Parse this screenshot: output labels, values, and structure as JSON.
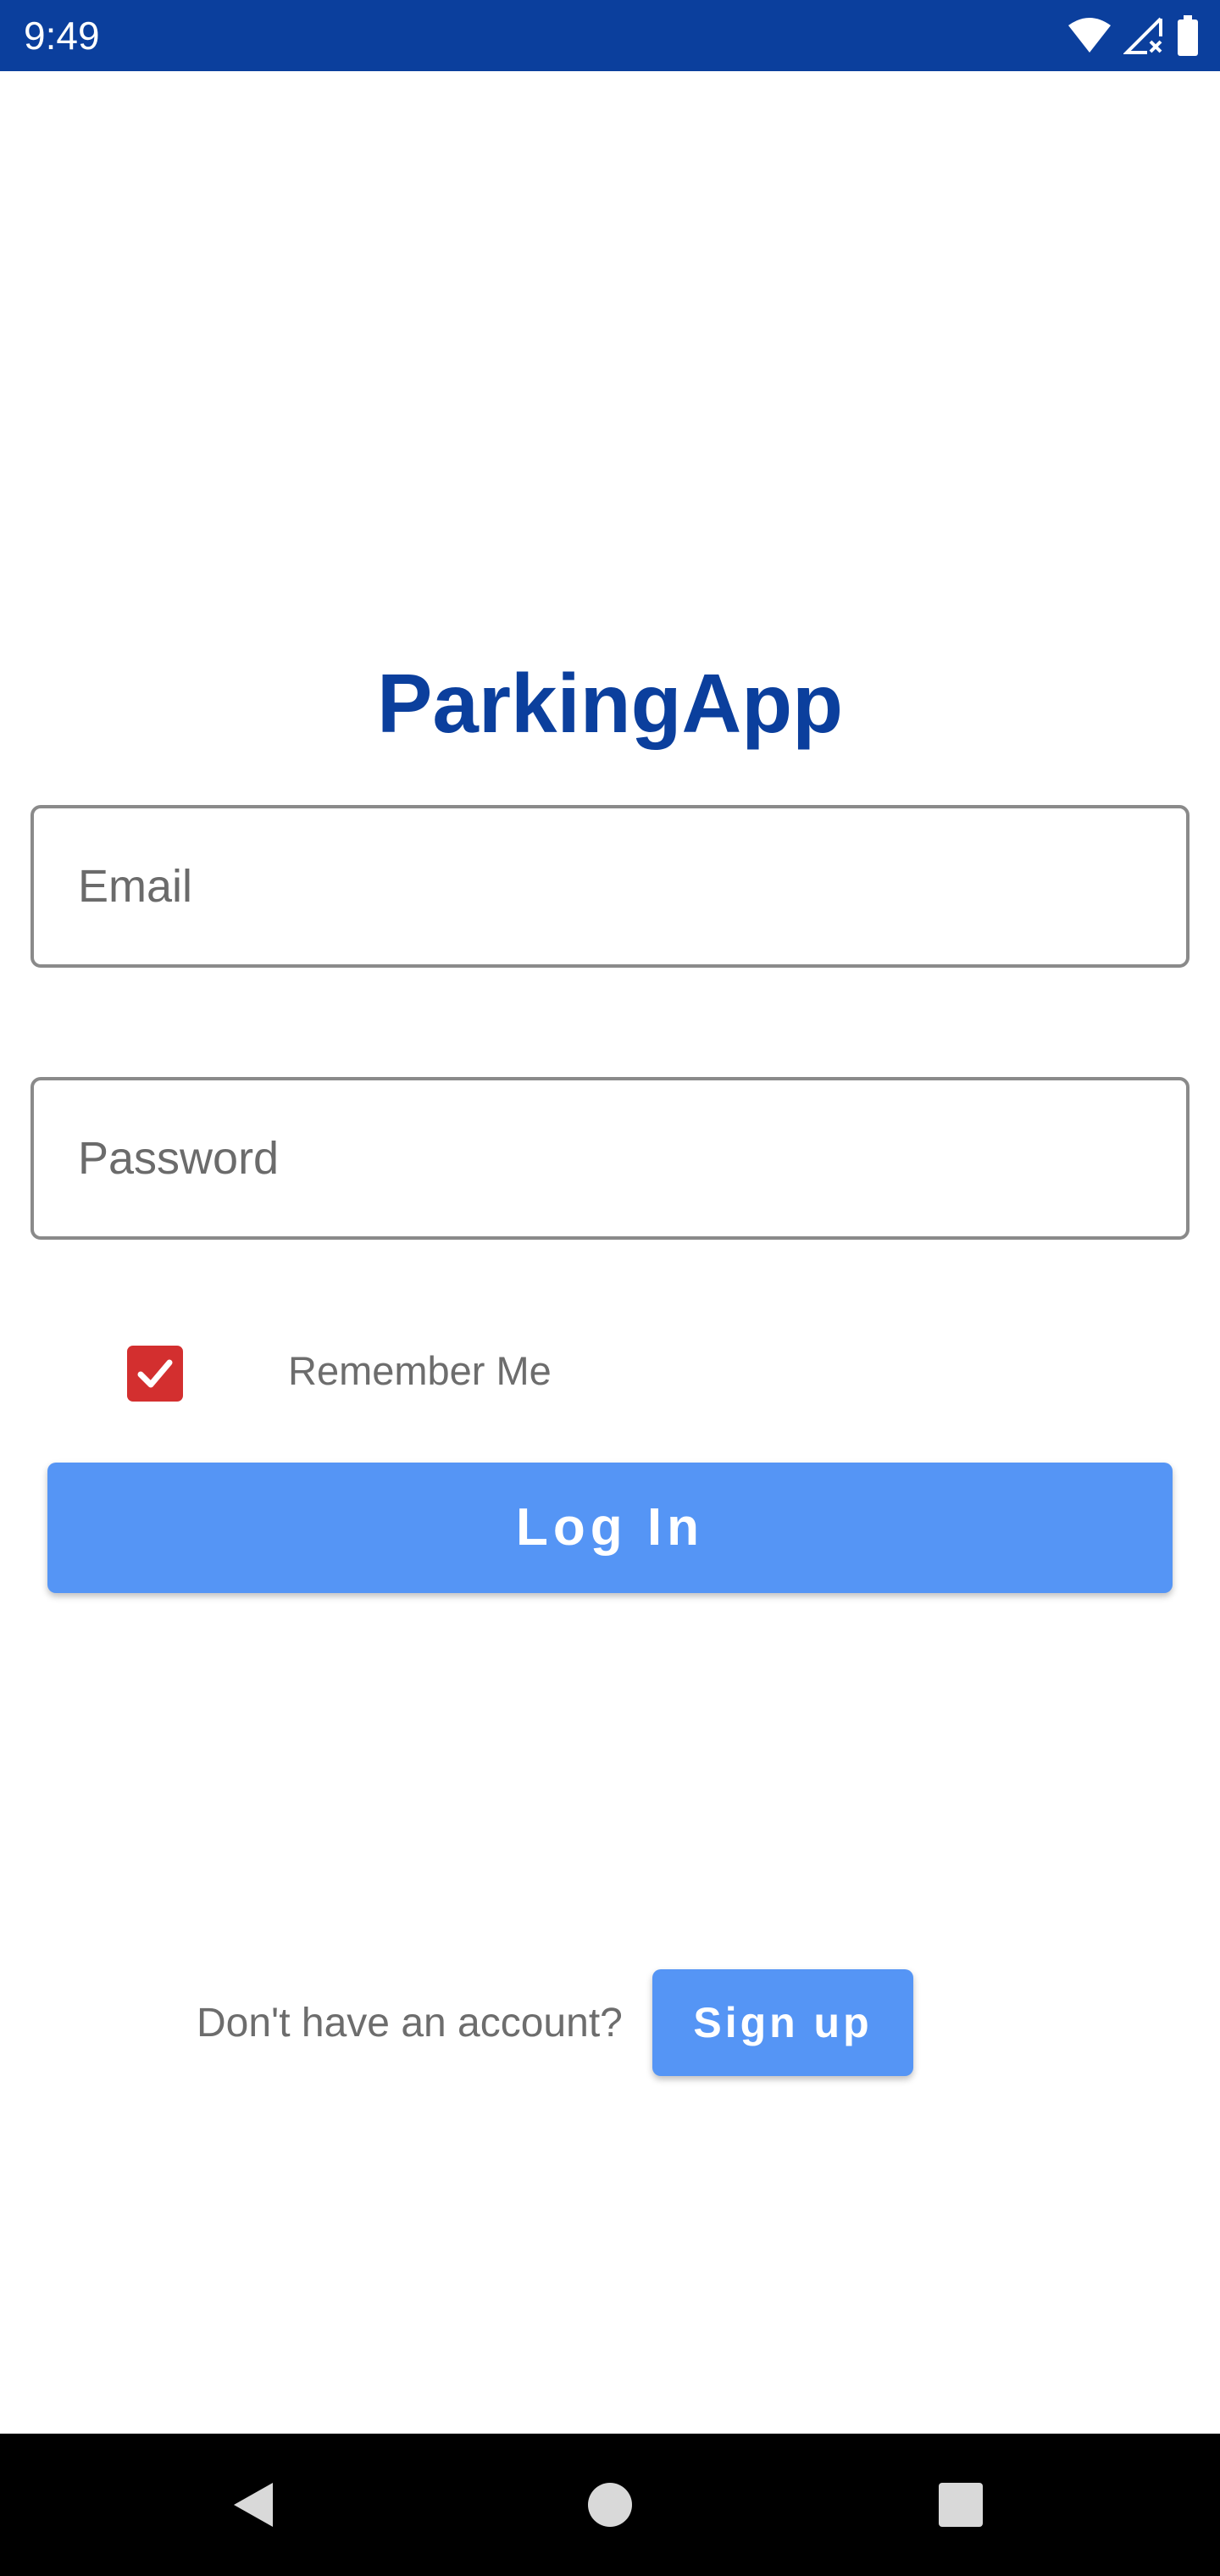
{
  "status_bar": {
    "time": "9:49",
    "icons": [
      "wifi-icon",
      "signal-icon",
      "battery-icon"
    ],
    "background_color": "#0b3f9d"
  },
  "app": {
    "title": "ParkingApp",
    "title_color": "#0b3f9d"
  },
  "form": {
    "email": {
      "placeholder": "Email",
      "value": ""
    },
    "password": {
      "placeholder": "Password",
      "value": ""
    },
    "remember_me": {
      "label": "Remember Me",
      "checked": true,
      "color": "#d32f2f"
    },
    "login_button": {
      "label": "Log In",
      "color": "#5595f5"
    }
  },
  "signup": {
    "prompt": "Don't have an account?",
    "button_label": "Sign up"
  },
  "nav_bar": {
    "buttons": [
      "back-icon",
      "home-icon",
      "recents-icon"
    ]
  }
}
